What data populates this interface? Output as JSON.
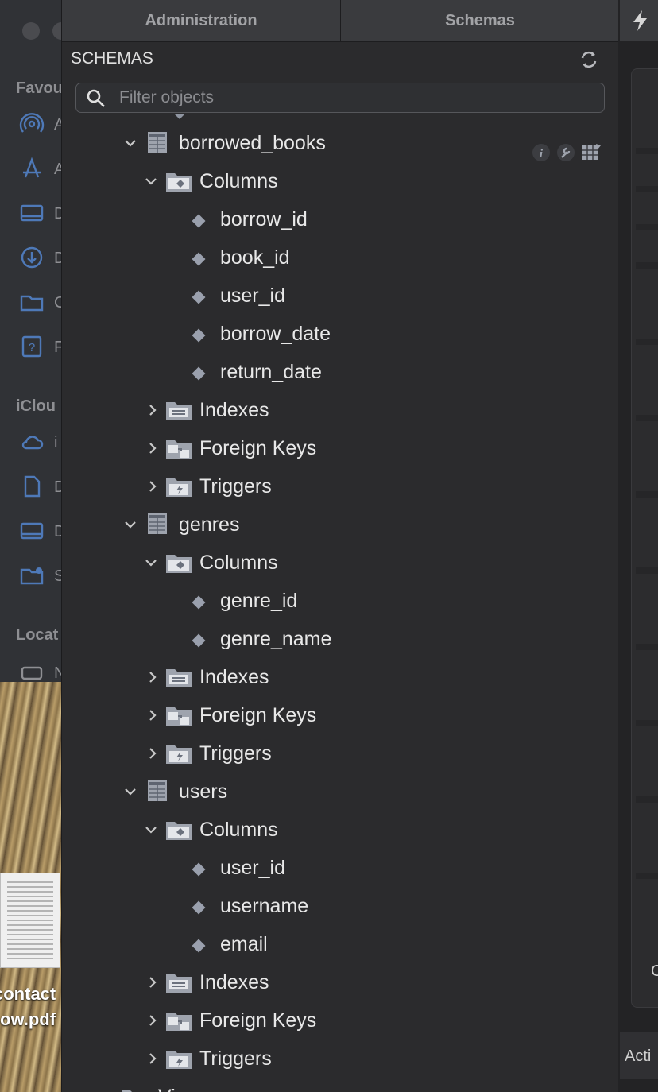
{
  "finder": {
    "sections": [
      "Favou",
      "iClou",
      "Locat"
    ],
    "letters": [
      "A",
      "A",
      "D",
      "D",
      "C",
      "F",
      "i",
      "D",
      "D",
      "S",
      "N"
    ]
  },
  "desktop": {
    "file_label_line1": "contact",
    "file_label_line2": "ow.pdf"
  },
  "panel": {
    "tabs": [
      "Administration",
      "Schemas"
    ],
    "header": "SCHEMAS",
    "filter_placeholder": "Filter objects"
  },
  "tree": {
    "tables": [
      {
        "name": "borrowed_books",
        "columns_label": "Columns",
        "columns": [
          "borrow_id",
          "book_id",
          "user_id",
          "borrow_date",
          "return_date"
        ],
        "indexes_label": "Indexes",
        "foreign_keys_label": "Foreign Keys",
        "triggers_label": "Triggers"
      },
      {
        "name": "genres",
        "columns_label": "Columns",
        "columns": [
          "genre_id",
          "genre_name"
        ],
        "indexes_label": "Indexes",
        "foreign_keys_label": "Foreign Keys",
        "triggers_label": "Triggers"
      },
      {
        "name": "users",
        "columns_label": "Columns",
        "columns": [
          "user_id",
          "username",
          "email"
        ],
        "indexes_label": "Indexes",
        "foreign_keys_label": "Foreign Keys",
        "triggers_label": "Triggers"
      }
    ],
    "next_node_partial": "Views"
  },
  "right_pane": {
    "letter": "C",
    "bottom_label": "Acti"
  },
  "icons": {
    "chevron_expanded": "chevron-down-icon",
    "chevron_collapsed": "chevron-right-icon",
    "table": "table-icon",
    "columns_folder": "columns-folder-icon",
    "column": "column-diamond-icon",
    "indexes": "indexes-icon",
    "foreign_keys": "foreign-keys-icon",
    "triggers": "triggers-icon"
  },
  "colors": {
    "panel_bg": "#2b2b2d",
    "tab_bg": "#3a3b3e",
    "text": "#e8e8e8",
    "muted": "#a2a3a6",
    "icon_gray": "#8f95a1"
  }
}
